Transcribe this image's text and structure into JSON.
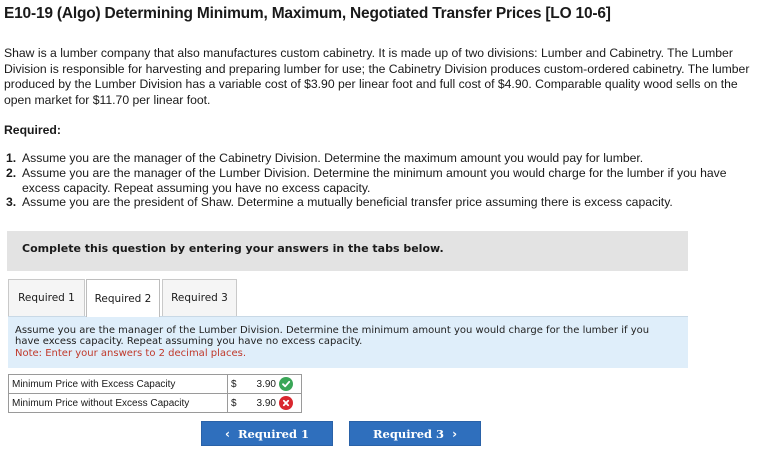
{
  "header": {
    "title": "E10-19 (Algo) Determining Minimum, Maximum, Negotiated Transfer Prices [LO 10-6]"
  },
  "problem": {
    "paragraph": "Shaw is a lumber company that also manufactures custom cabinetry. It is made up of two divisions: Lumber and Cabinetry. The Lumber Division is responsible for harvesting and preparing lumber for use; the Cabinetry Division produces custom-ordered cabinetry. The lumber produced by the Lumber Division has a variable cost of $3.90 per linear foot and full cost of $4.90. Comparable quality wood sells on the open market for $11.70 per linear foot.",
    "required_label": "Required:",
    "requirements": [
      {
        "num": "1.",
        "text": "Assume you are the manager of the Cabinetry Division. Determine the maximum amount you would pay for lumber."
      },
      {
        "num": "2.",
        "text": "Assume you are the manager of the Lumber Division. Determine the minimum amount you would charge for the lumber if you have excess capacity. Repeat assuming you have no excess capacity."
      },
      {
        "num": "3.",
        "text": "Assume you are the president of Shaw. Determine a mutually beneficial transfer price assuming there is excess capacity."
      }
    ]
  },
  "instructions": "Complete this question by entering your answers in the tabs below.",
  "tabs": [
    {
      "label": "Required 1",
      "active": false
    },
    {
      "label": "Required 2",
      "active": true
    },
    {
      "label": "Required 3",
      "active": false
    }
  ],
  "panel": {
    "text": "Assume you are the manager of the Lumber Division. Determine the minimum amount you would charge for the lumber if you have excess capacity. Repeat assuming you have no excess capacity.",
    "note": "Note: Enter your answers to 2 decimal places."
  },
  "answers": [
    {
      "label": "Minimum Price with Excess Capacity",
      "currency": "$",
      "value": "3.90",
      "status": "correct",
      "status_icon": "check-icon",
      "status_color": "#3aa657"
    },
    {
      "label": "Minimum Price without Excess Capacity",
      "currency": "$",
      "value": "3.90",
      "status": "incorrect",
      "status_icon": "x-icon",
      "status_color": "#d9272e"
    }
  ],
  "navigation": {
    "prev_label": "Required 1",
    "next_label": "Required 3",
    "prev_glyph": "‹",
    "next_glyph": "›",
    "button_color": "#2f6fbd"
  }
}
